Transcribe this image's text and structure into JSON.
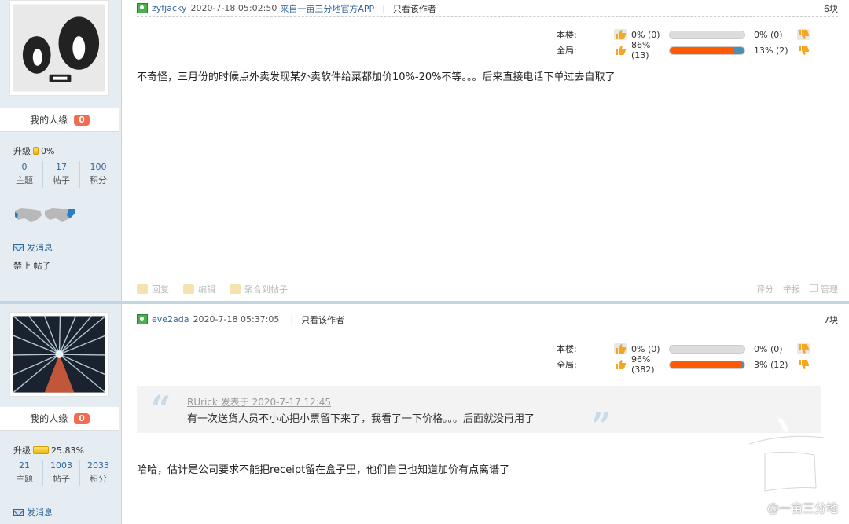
{
  "colors": {
    "accent": "#336699",
    "badge": "#f26c4f",
    "upbar": "#ff5a00",
    "downbar": "#4a90b0",
    "sidebar": "#e5edf2"
  },
  "posts": [
    {
      "avatar": "cartoon-face-avatar",
      "renyuan_label": "我的人缘",
      "renyuan_value": "0",
      "level_label": "升级",
      "level_pct": "0%",
      "level_fraction": 0.0,
      "stats": [
        {
          "num": "0",
          "label": "主题"
        },
        {
          "num": "17",
          "label": "帖子"
        },
        {
          "num": "100",
          "label": "积分"
        }
      ],
      "send_msg": "发消息",
      "banned": "禁止 帖子",
      "author": "zyfjacky",
      "time": "2020-7-18 05:02:50",
      "app": "来自一亩三分地官方APP",
      "only_author": "只看该作者",
      "floor": "6块",
      "vote": {
        "local_label": "本楼:",
        "local_up": "0% (0)",
        "local_down": "0% (0)",
        "local_fraction": 0.0,
        "global_label": "全局:",
        "global_up": "86% (13)",
        "global_down": "13% (2)",
        "global_fraction": 0.86
      },
      "message": "不奇怪，三月份的时候点外卖发现某外卖软件给菜都加价10%-20%不等。。。后来直接电话下单过去自取了",
      "actions": {
        "reply": "回复",
        "edit": "编辑",
        "collect": "聚合到帖子",
        "rate": "评分",
        "report": "举报",
        "manage": "管理"
      }
    },
    {
      "avatar": "forest-looking-up-avatar",
      "renyuan_label": "我的人缘",
      "renyuan_value": "0",
      "level_label": "升级",
      "level_pct": "25.83%",
      "level_fraction": 0.2583,
      "stats": [
        {
          "num": "21",
          "label": "主题"
        },
        {
          "num": "1003",
          "label": "帖子"
        },
        {
          "num": "2033",
          "label": "积分"
        }
      ],
      "send_msg": "发消息",
      "author": "eve2ada",
      "time": "2020-7-18 05:37:05",
      "only_author": "只看该作者",
      "floor": "7块",
      "vote": {
        "local_label": "本楼:",
        "local_up": "0% (0)",
        "local_down": "0% (0)",
        "local_fraction": 0.0,
        "global_label": "全局:",
        "global_up": "96% (382)",
        "global_down": "3% (12)",
        "global_fraction": 0.96
      },
      "quote_author": "RUrick 发表于 2020-7-17 12:45",
      "quote_text": "有一次送货人员不小心把小票留下来了，我看了一下价格。。。后面就没再用了",
      "message": "哈哈，估计是公司要求不能把receipt留在盒子里，他们自己也知道加价有点离谱了"
    }
  ],
  "watermark": "@一亩三分地"
}
